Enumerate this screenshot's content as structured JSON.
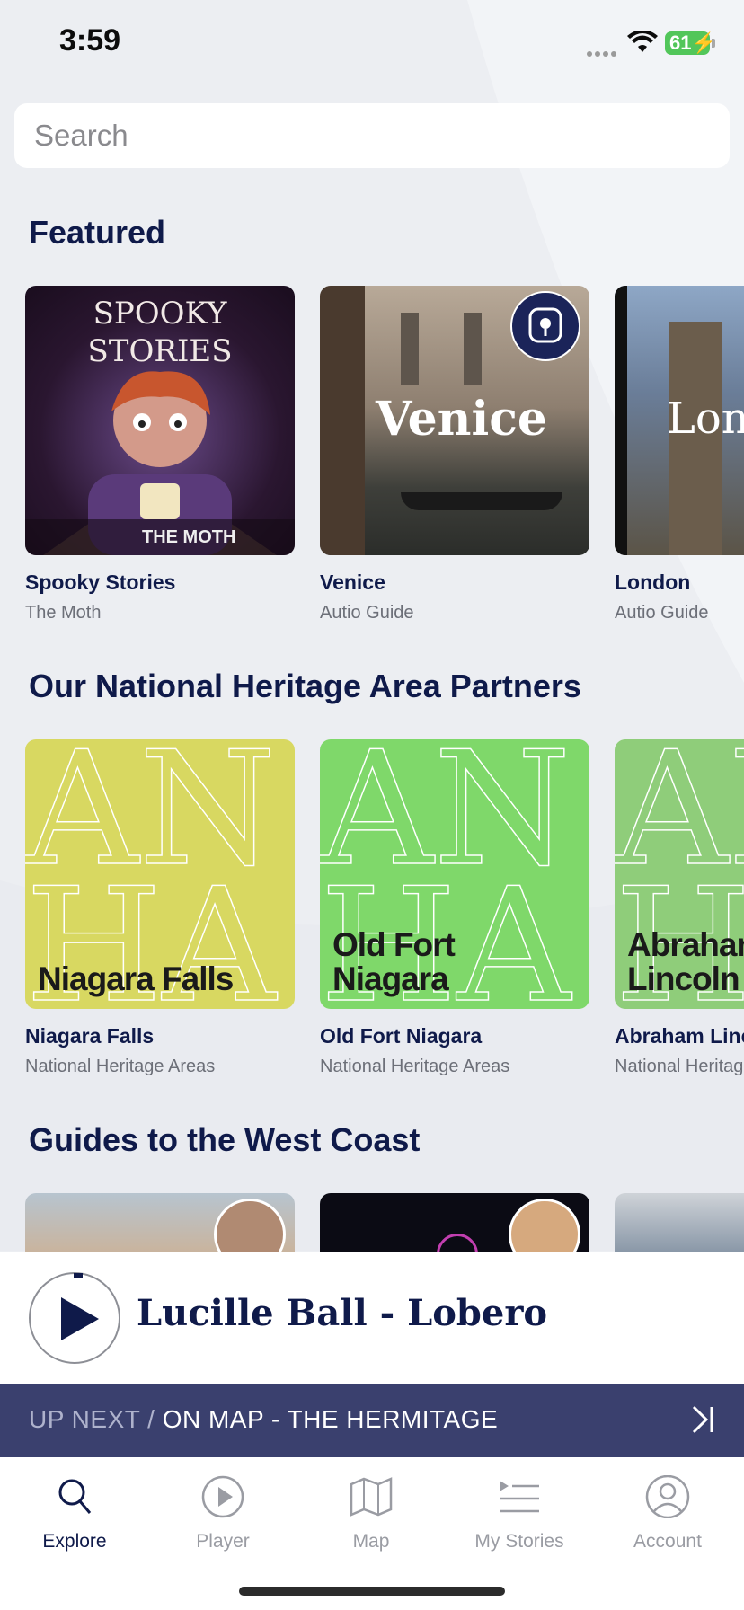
{
  "status": {
    "time": "3:59",
    "battery": "61"
  },
  "search": {
    "placeholder": "Search"
  },
  "sections": {
    "featured": {
      "title": "Featured",
      "items": [
        {
          "title": "Spooky Stories",
          "subtitle": "The Moth",
          "art_line1": "SPOOKY",
          "art_line2": "STORIES",
          "art_brand": "THE MOTH"
        },
        {
          "title": "Venice",
          "subtitle": "Autio Guide",
          "art_text": "Venice"
        },
        {
          "title": "London",
          "subtitle": "Autio Guide",
          "art_text": "Lon"
        }
      ]
    },
    "heritage": {
      "title": "Our National Heritage Area Partners",
      "items": [
        {
          "title": "Niagara Falls",
          "subtitle": "National Heritage Areas",
          "art_label": "Niagara Falls",
          "color": "#d8d861"
        },
        {
          "title": "Old Fort Niagara",
          "subtitle": "National Heritage Areas",
          "art_label_line1": "Old Fort",
          "art_label_line2": "Niagara",
          "color": "#7fd86a"
        },
        {
          "title": "Abraham Lincoln",
          "subtitle": "National Heritage Areas",
          "art_label_line1": "Abraham",
          "art_label_line2": "Lincoln",
          "color": "#8fcd7a"
        }
      ]
    },
    "west_coast": {
      "title": "Guides to the West Coast"
    }
  },
  "mini_player": {
    "title": "Lucille Ball - Lobero"
  },
  "up_next": {
    "prefix": "UP NEXT /",
    "label": "ON MAP - THE HERMITAGE"
  },
  "tabs": [
    {
      "label": "Explore",
      "icon": "search-icon",
      "active": true
    },
    {
      "label": "Player",
      "icon": "play-circle-icon",
      "active": false
    },
    {
      "label": "Map",
      "icon": "map-icon",
      "active": false
    },
    {
      "label": "My Stories",
      "icon": "list-icon",
      "active": false
    },
    {
      "label": "Account",
      "icon": "person-icon",
      "active": false
    }
  ],
  "colors": {
    "navy": "#0f1a4a",
    "up_next_bg": "#3a406e",
    "battery": "#52c65a"
  }
}
